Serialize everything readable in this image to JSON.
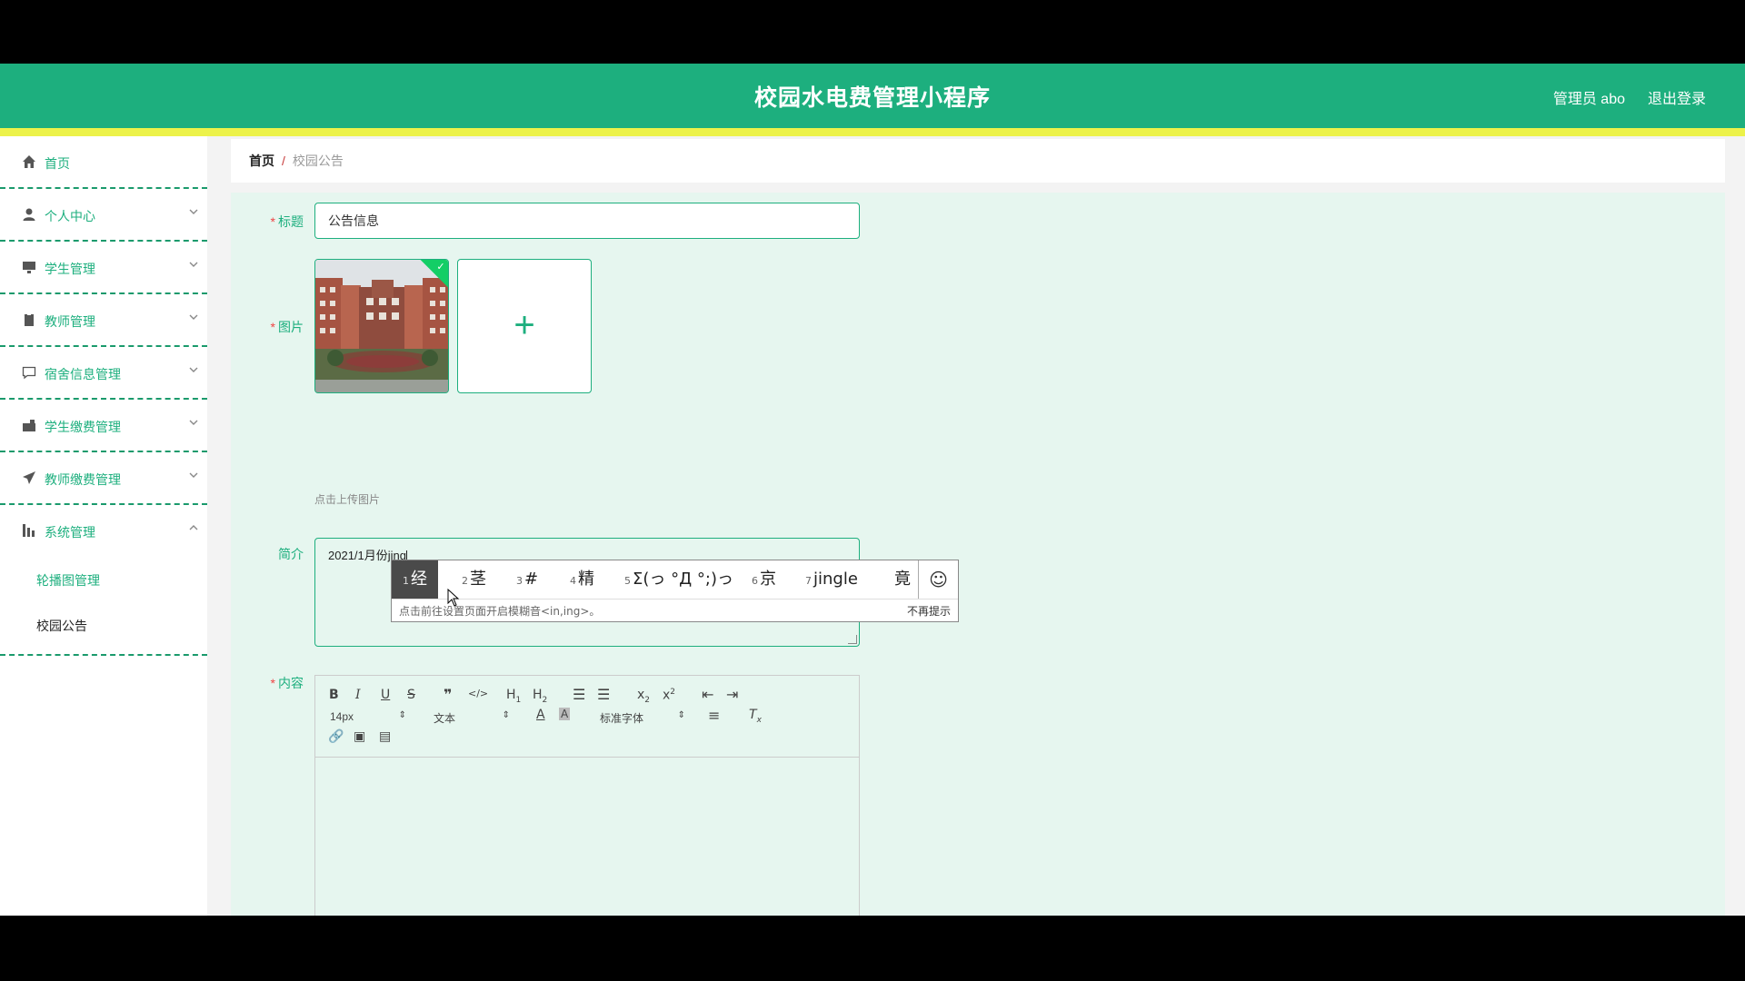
{
  "header": {
    "title": "校园水电费管理小程序",
    "user": "管理员 abo",
    "logout": "退出登录"
  },
  "sidebar": {
    "items": [
      {
        "label": "首页",
        "icon": "home-icon"
      },
      {
        "label": "个人中心",
        "icon": "user-icon"
      },
      {
        "label": "学生管理",
        "icon": "monitor-icon"
      },
      {
        "label": "教师管理",
        "icon": "clipboard-icon"
      },
      {
        "label": "宿舍信息管理",
        "icon": "chat-icon"
      },
      {
        "label": "学生缴费管理",
        "icon": "suitcase-icon"
      },
      {
        "label": "教师缴费管理",
        "icon": "send-icon"
      },
      {
        "label": "系统管理",
        "icon": "chart-icon"
      }
    ],
    "sub_items": [
      {
        "label": "轮播图管理"
      },
      {
        "label": "校园公告"
      }
    ]
  },
  "breadcrumb": {
    "home": "首页",
    "sep": "/",
    "current": "校园公告"
  },
  "form": {
    "title_label": "标题",
    "title_value": "公告信息",
    "image_label": "图片",
    "upload_hint": "点击上传图片",
    "intro_label": "简介",
    "intro_value": "2021/1月份jing",
    "content_label": "内容",
    "required_mark": "*"
  },
  "ime": {
    "candidates": [
      {
        "num": "1",
        "text": "经"
      },
      {
        "num": "2",
        "text": "茎"
      },
      {
        "num": "3",
        "text": "#"
      },
      {
        "num": "4",
        "text": "精"
      },
      {
        "num": "5",
        "text": "Σ(っ °Д °;)っ"
      },
      {
        "num": "6",
        "text": "京"
      },
      {
        "num": "7",
        "text": "jingle"
      },
      {
        "num": "",
        "text": "竟"
      }
    ],
    "emoji": "☺",
    "footer": "点击前往设置页面开启模糊音<in,ing>。",
    "dismiss": "不再提示"
  },
  "editor": {
    "font_size": "14px",
    "text_type": "文本",
    "font_family": "标准字体"
  },
  "colors": {
    "primary": "#1daf7e",
    "accent_bar": "#ecf24a",
    "form_bg": "#e6f6ef"
  }
}
